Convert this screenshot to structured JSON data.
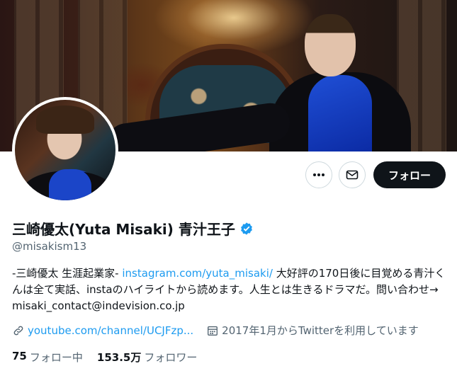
{
  "profile": {
    "display_name": "三崎優太(Yuta Misaki) 青汁王子",
    "handle": "@misakism13",
    "verified": true,
    "bio": {
      "part1": "-三崎優太 生涯起業家- ",
      "link": "instagram.com/yuta_misaki/",
      "part2": " 大好評の170日後に目覚める青汁くんは全て実話、instaのハイライトから読めます。人生とは生きるドラマだ。問い合わせ→ misaki_contact@indevision.co.jp"
    },
    "website": "youtube.com/channel/UCJFzp...",
    "joined": "2017年1月からTwitterを利用しています",
    "following_count": "75",
    "following_label": "フォロー中",
    "followers_count": "153.5万",
    "followers_label": "フォロワー"
  },
  "actions": {
    "more_icon": "more-horizontal-icon",
    "message_icon": "envelope-icon",
    "follow_label": "フォロー"
  },
  "colors": {
    "accent": "#1d9bf0",
    "text_primary": "#0f1419",
    "text_secondary": "#536471",
    "button_dark": "#0f1419"
  }
}
